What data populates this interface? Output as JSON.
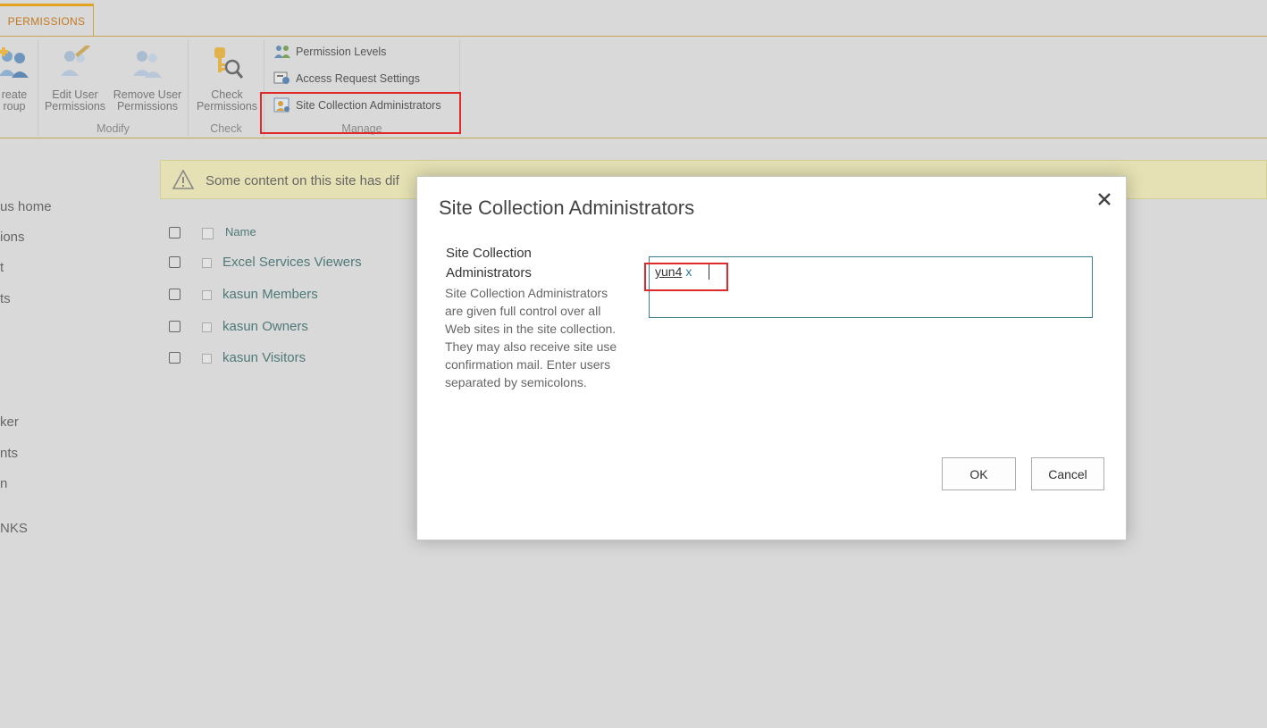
{
  "ribbon": {
    "tab_label": "PERMISSIONS",
    "groups": {
      "grant": {
        "create_group_line1": "reate",
        "create_group_line2": "roup"
      },
      "modify": {
        "label": "Modify",
        "edit_user_line1": "Edit User",
        "edit_user_line2": "Permissions",
        "remove_user_line1": "Remove User",
        "remove_user_line2": "Permissions"
      },
      "check": {
        "label": "Check",
        "check_line1": "Check",
        "check_line2": "Permissions"
      },
      "manage": {
        "label": "Manage",
        "permission_levels": "Permission Levels",
        "access_request": "Access Request Settings",
        "site_collection_admins": "Site Collection Administrators"
      }
    }
  },
  "leftnav": {
    "items": [
      "us home",
      "ions",
      "t",
      "ts",
      "ker",
      "nts",
      "n",
      "NKS"
    ]
  },
  "banner": {
    "text": "Some content on this site has dif"
  },
  "list": {
    "header": "Name",
    "rows": [
      "Excel Services Viewers",
      "kasun Members",
      "kasun Owners",
      "kasun Visitors"
    ]
  },
  "dialog": {
    "title": "Site Collection Administrators",
    "section_title": "Site Collection Administrators",
    "description": "Site Collection Administrators are given full control over all Web sites in the site collection. They may also receive site use confirmation mail. Enter users separated by semicolons.",
    "people_picker": {
      "resolved_user": "yun4",
      "remove_glyph": "x"
    },
    "ok_label": "OK",
    "cancel_label": "Cancel"
  },
  "colors": {
    "accent_tab": "#e3a31f",
    "link": "#4f7a77",
    "highlight": "#e02a2a",
    "picker_border": "#3d7d8a"
  }
}
